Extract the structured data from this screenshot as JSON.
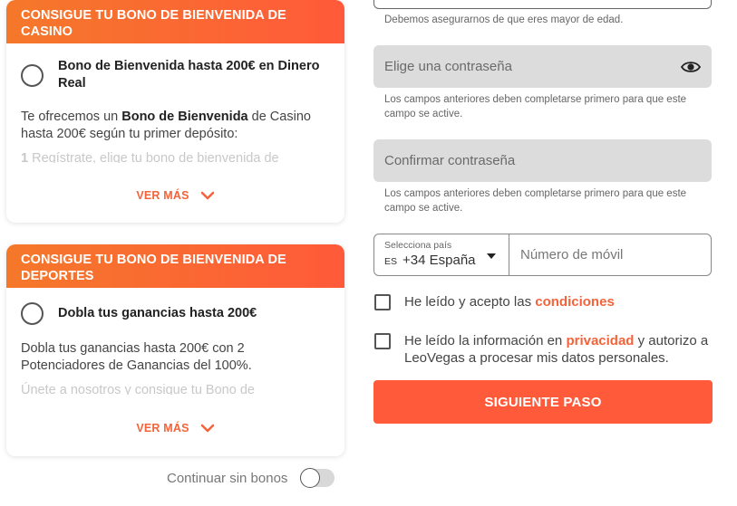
{
  "casino_card": {
    "header": "CONSIGUE TU BONO DE BIENVENIDA DE CASINO",
    "option_title": "Bono de Bienvenida hasta 200€ en Dinero Real",
    "desc_pre": "Te ofrecemos un ",
    "desc_bold": "Bono de Bienvenida",
    "desc_post": " de Casino hasta 200€ según tu primer depósito:",
    "fade_num": "1",
    "fade_text": "Regístrate, elige tu bono de bienvenida de",
    "ver_mas": "VER MÁS"
  },
  "sports_card": {
    "header": "CONSIGUE TU BONO DE BIENVENIDA DE DEPORTES",
    "option_title": "Dobla tus ganancias hasta 200€",
    "desc": "Dobla tus ganancias hasta 200€ con 2 Potenciadores de Ganancias del 100%.",
    "fade_text": "Únete a nosotros y consigue tu Bono de",
    "ver_mas": "VER MÁS"
  },
  "no_bonus": {
    "label": "Continuar sin bonos",
    "enabled": false
  },
  "form": {
    "age_help": "Debemos asegurarnos de que eres mayor de edad.",
    "password_placeholder": "Elige una contraseña",
    "password_help": "Los campos anteriores deben completarse primero para que este campo se active.",
    "confirm_placeholder": "Confirmar contraseña",
    "confirm_help": "Los campos anteriores deben completarse primero para que este campo se active.",
    "country_label": "Selecciona país",
    "country_code": "ES",
    "country_value": "+34 España",
    "phone_placeholder": "Número de móvil",
    "terms_pre": "He leído y acepto las ",
    "terms_link": "condiciones",
    "privacy_pre": "He leído la información en ",
    "privacy_link": "privacidad",
    "privacy_post": " y autorizo a LeoVegas a procesar mis datos personales.",
    "submit_label": "SIGUIENTE PASO"
  },
  "colors": {
    "accent": "#ff5a3a",
    "link": "#f4633a",
    "header_gradient_start": "#f5782a",
    "disabled_field": "#dcdcdc"
  }
}
